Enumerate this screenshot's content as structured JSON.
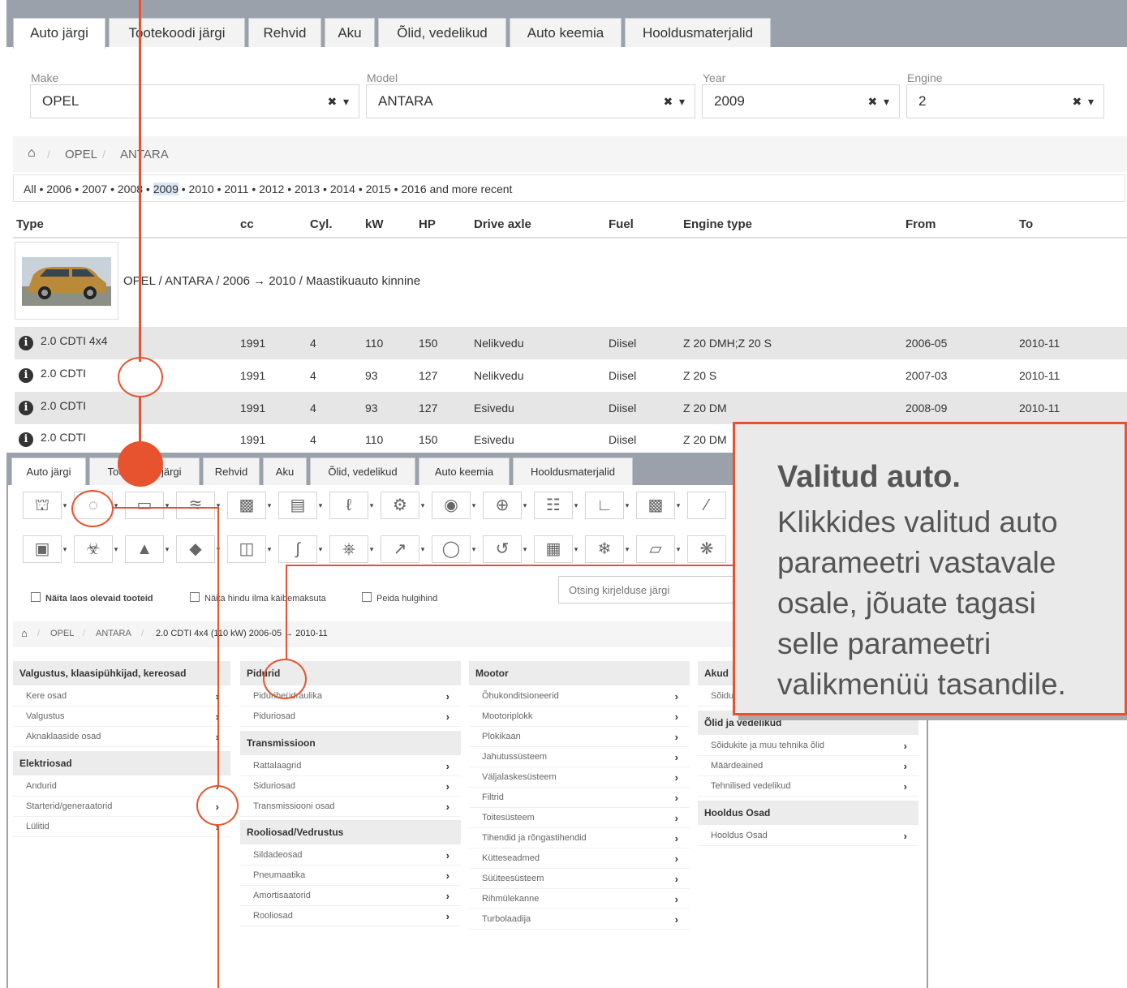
{
  "top": {
    "tabs": [
      "Auto järgi",
      "Tootekoodi järgi",
      "Rehvid",
      "Aku",
      "Õlid, vedelikud",
      "Auto keemia",
      "Hooldusmaterjalid"
    ],
    "selectors": [
      {
        "label": "Make",
        "value": "OPEL"
      },
      {
        "label": "Model",
        "value": "ANTARA"
      },
      {
        "label": "Year",
        "value": "2009"
      },
      {
        "label": "Engine",
        "value": "2"
      }
    ],
    "clear_glyph": "✖",
    "caret_glyph": "▾",
    "breadcrumb": [
      "OPEL",
      "ANTARA"
    ],
    "years_prefix": "All • 2006 • 2007 • 2008 • ",
    "years_selected": "2009",
    "years_suffix": " • 2010 • 2011 • 2012 • 2013 • 2014 • 2015 • 2016 and more recent",
    "columns": [
      "Type",
      "cc",
      "Cyl.",
      "kW",
      "HP",
      "Drive axle",
      "Fuel",
      "Engine type",
      "From",
      "To"
    ],
    "group_label": "OPEL / ANTARA / 2006 → 2010 / Maastikuauto kinnine",
    "rows": [
      {
        "type": "2.0 CDTI 4x4",
        "cc": "1991",
        "cyl": "4",
        "kw": "110",
        "hp": "150",
        "drive": "Nelikvedu",
        "fuel": "Diisel",
        "engine": "Z 20 DMH;Z 20 S",
        "from": "2006-05",
        "to": "2010-11"
      },
      {
        "type": "2.0 CDTI",
        "cc": "1991",
        "cyl": "4",
        "kw": "93",
        "hp": "127",
        "drive": "Nelikvedu",
        "fuel": "Diisel",
        "engine": "Z 20 S",
        "from": "2007-03",
        "to": "2010-11"
      },
      {
        "type": "2.0 CDTI",
        "cc": "1991",
        "cyl": "4",
        "kw": "93",
        "hp": "127",
        "drive": "Esivedu",
        "fuel": "Diisel",
        "engine": "Z 20 DM",
        "from": "2008-09",
        "to": "2010-11"
      },
      {
        "type": "2.0 CDTI",
        "cc": "1991",
        "cyl": "4",
        "kw": "110",
        "hp": "150",
        "drive": "Esivedu",
        "fuel": "Diisel",
        "engine": "Z 20 DM",
        "from": "",
        "to": ""
      }
    ]
  },
  "bottom": {
    "tabs": [
      "Auto järgi",
      "Tootekoodi järgi",
      "Rehvid",
      "Aku",
      "Õlid, vedelikud",
      "Auto keemia",
      "Hooldusmaterjalid"
    ],
    "checkboxes": [
      "Näita laos olevaid tooteid",
      "Näita hindu ilma käibemaksuta",
      "Peida hulgihind"
    ],
    "search_placeholder": "Otsing kirjelduse järgi",
    "breadcrumb": [
      "OPEL",
      "ANTARA",
      "2.0 CDTI 4x4 (110 kW) 2006-05 → 2010-11"
    ],
    "icons_row1": [
      "car-body-icon",
      "headlight-icon",
      "bumper-icon",
      "exhaust-icon",
      "engine-part-icon",
      "radiator-icon",
      "seat-icon",
      "brake-disc-icon",
      "disc-icon",
      "wheel-hub-icon",
      "gearbox-icon",
      "seat-belt-icon",
      "filter-icon",
      "wiper-icon"
    ],
    "icons_row2": [
      "battery-icon",
      "clutch-icon",
      "spark-plug-icon",
      "gasket-icon",
      "window-icon",
      "pedal-icon",
      "intake-icon",
      "shock-absorber-icon",
      "belt-pulley-icon",
      "turbo-icon",
      "fuse-box-icon",
      "air-con-icon",
      "bottle-icon",
      "fan-icon"
    ],
    "columns": [
      {
        "groups": [
          {
            "title": "Valgustus, klaasipühkijad, kereosad",
            "items": [
              "Kere osad",
              "Valgustus",
              "Aknaklaaside osad"
            ]
          },
          {
            "title": "Elektriosad",
            "items": [
              "Andurid",
              "Starterid/generaatorid",
              "Lülitid"
            ]
          }
        ]
      },
      {
        "groups": [
          {
            "title": "Pidurid",
            "items": [
              "Piduriheüdraulika",
              "Piduriosad"
            ]
          },
          {
            "title": "Transmissioon",
            "items": [
              "Rattalaagrid",
              "Siduriosad",
              "Transmissiooni osad"
            ]
          },
          {
            "title": "Rooliosad/Vedrustus",
            "items": [
              "Sildadeosad",
              "Pneumaatika",
              "Amortisaatorid",
              "Rooliosad"
            ]
          }
        ]
      },
      {
        "groups": [
          {
            "title": "Mootor",
            "items": [
              "Õhukonditsioneerid",
              "Mootoriplokk",
              "Plokikaan",
              "Jahutussüsteem",
              "Väljalaskesüsteem",
              "Filtrid",
              "Toitesüsteem",
              "Tihendid ja rõngastihendid",
              "Kütteseadmed",
              "Süüteesüsteem",
              "Rihmülekanne",
              "Turbolaadija"
            ]
          }
        ]
      },
      {
        "groups": [
          {
            "title": "Akud",
            "items": [
              "Sõidukite akud"
            ]
          },
          {
            "title": "Õlid ja vedelikud",
            "items": [
              "Sõidukite ja muu tehnika õlid",
              "Määrdeained",
              "Tehnilised vedelikud"
            ]
          },
          {
            "title": "Hooldus Osad",
            "items": [
              "Hooldus Osad"
            ]
          }
        ]
      }
    ],
    "arrow_glyph": "›"
  },
  "callout": {
    "title": "Valitud auto.",
    "lines": [
      "Klikkides valitud auto",
      "parameetri vastavale",
      "osale, jõuate tagasi",
      "selle parameetri",
      "valikmenüü tasandile."
    ]
  },
  "colors": {
    "accent": "#e8532f",
    "frame": "#9aa1ab",
    "row_shade": "#e6e6e6"
  }
}
